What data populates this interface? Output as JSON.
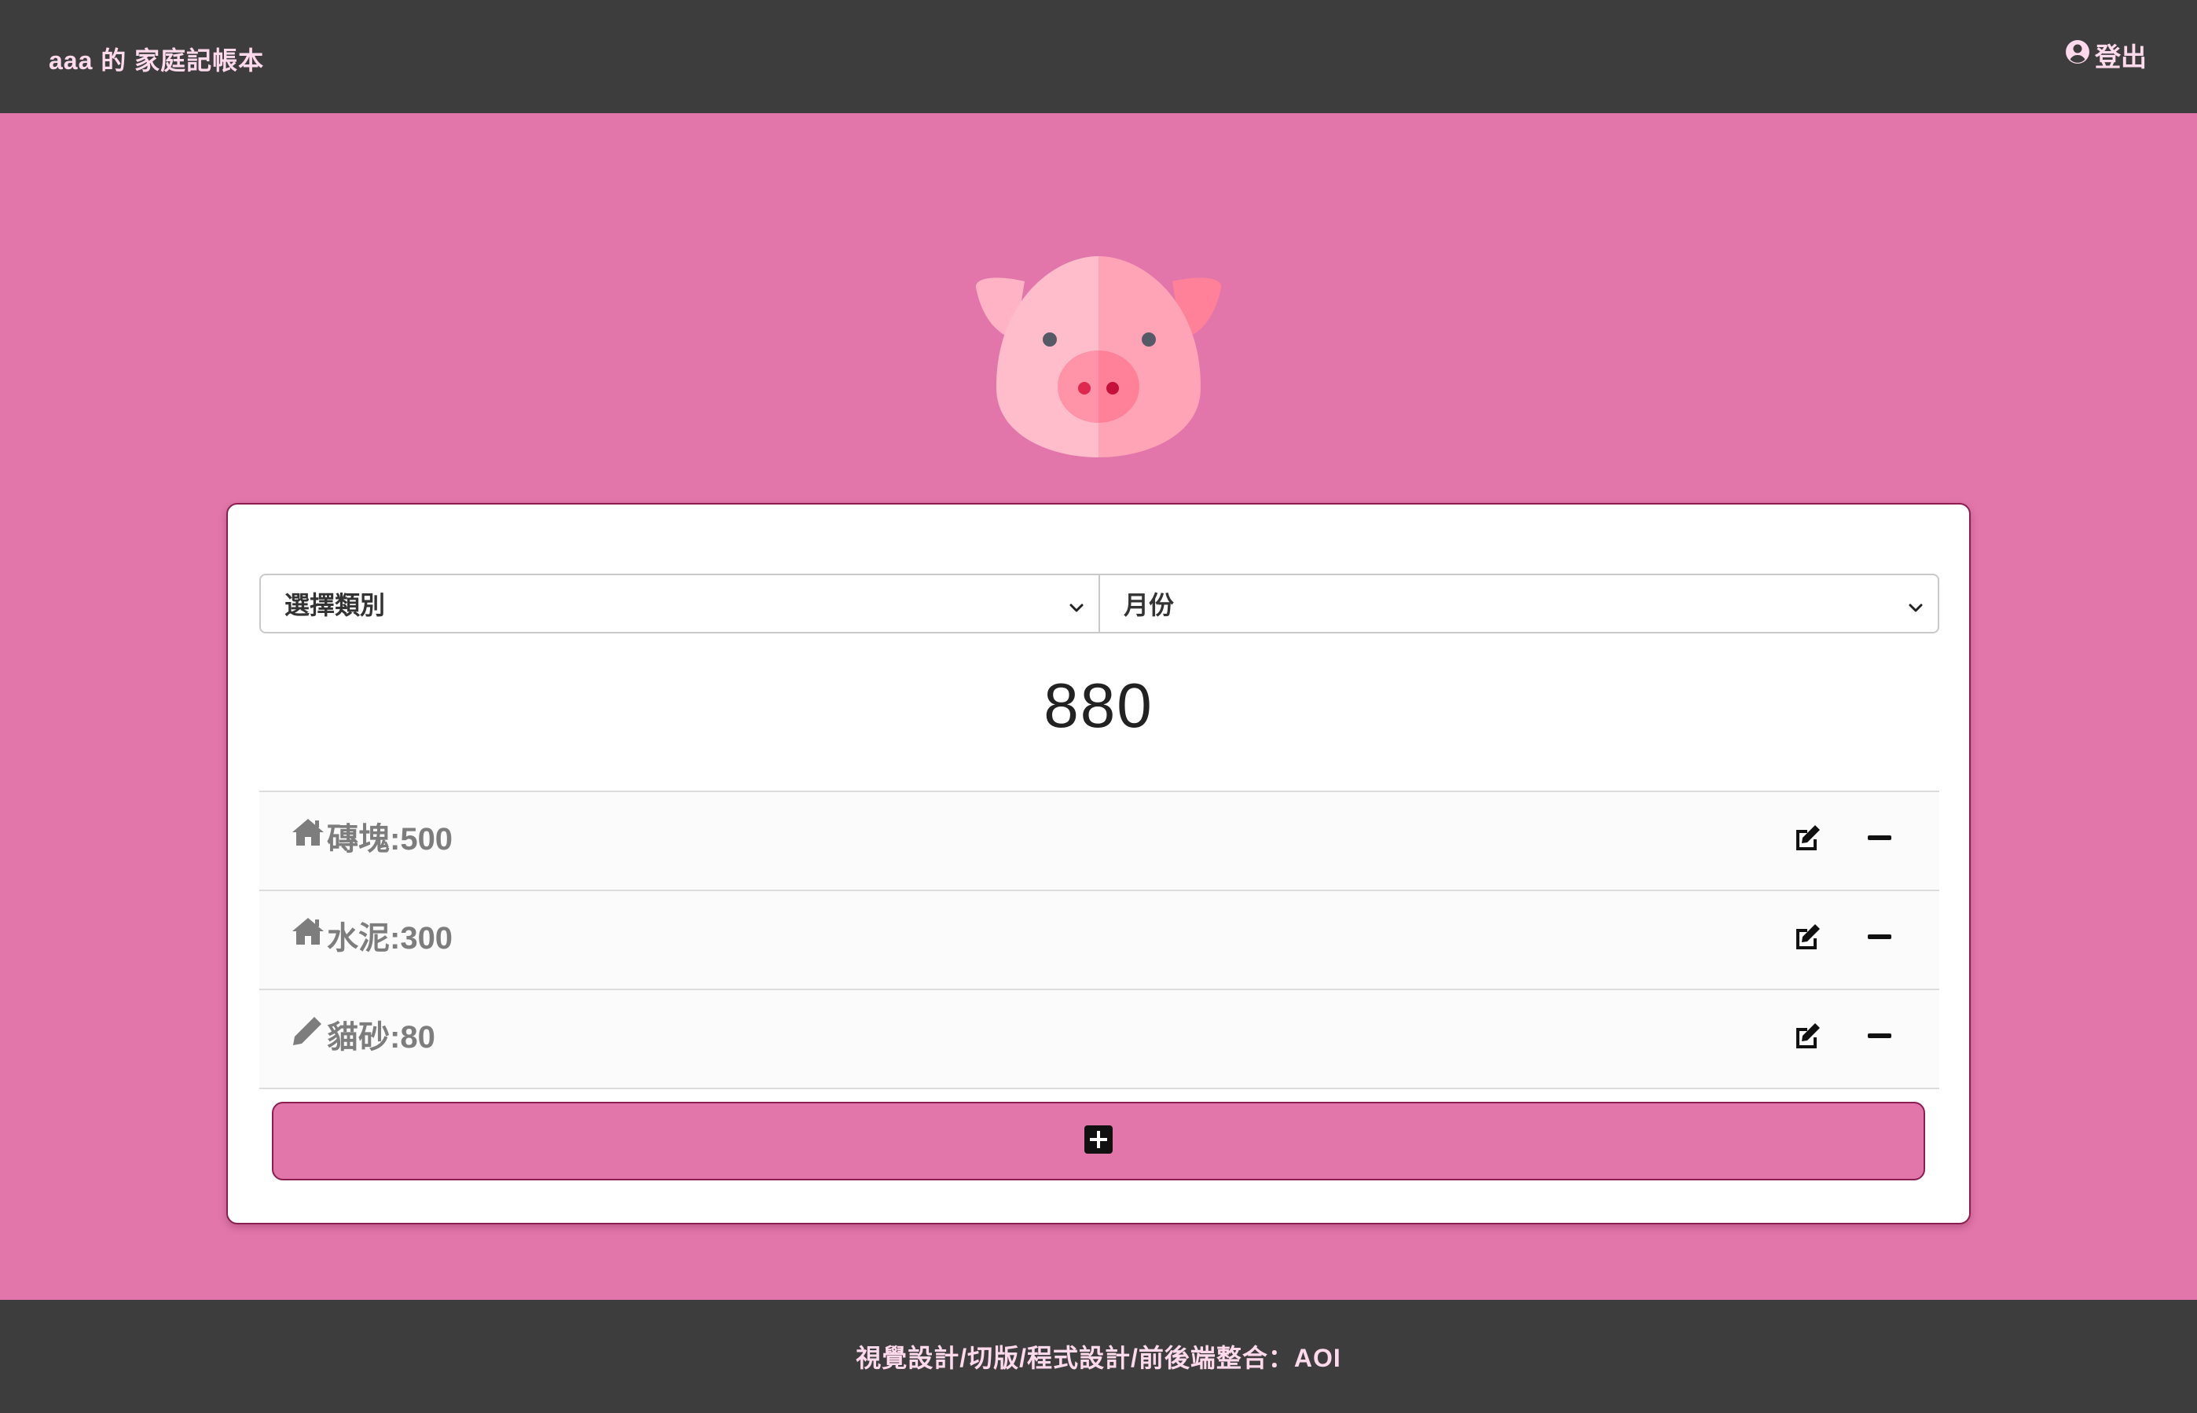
{
  "header": {
    "brand": "aaa 的 家庭記帳本",
    "logout_label": "登出",
    "logout_icon": "user-circle-icon"
  },
  "hero": {
    "image": "pig-face-icon"
  },
  "filters": {
    "category": {
      "selected": "選擇類別"
    },
    "month": {
      "selected": "月份"
    }
  },
  "total": "880",
  "records": [
    {
      "icon": "house-icon",
      "text": "磚塊:500"
    },
    {
      "icon": "house-icon",
      "text": "水泥:300"
    },
    {
      "icon": "pencil-icon",
      "text": "貓砂:80"
    }
  ],
  "record_actions": {
    "edit_icon": "edit-icon",
    "delete_icon": "minus-icon"
  },
  "add_button": {
    "icon": "plus-square-icon"
  },
  "footer": {
    "credit": "視覺設計/切版/程式設計/前後端整合：AOI"
  },
  "colors": {
    "background": "#e276aa",
    "bars": "#3d3d3d",
    "bar_text": "#ffd9ec",
    "card_border": "#8c1d50"
  }
}
